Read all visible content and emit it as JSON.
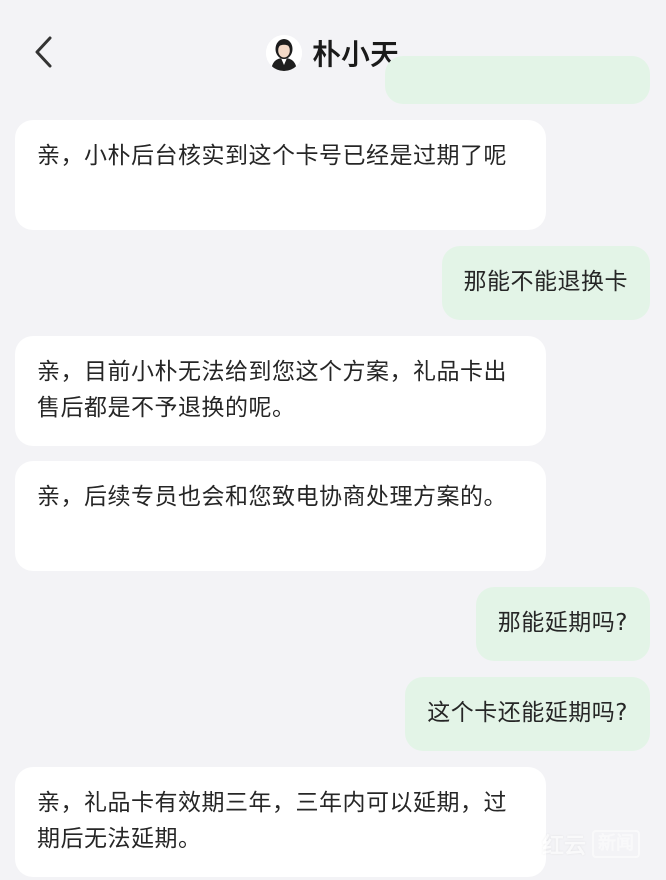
{
  "header": {
    "title": "朴小天",
    "back_icon": "chevron-left-icon",
    "avatar_icon": "agent-avatar"
  },
  "messages": [
    {
      "side": "right",
      "text": ""
    },
    {
      "side": "left",
      "text": "亲，小朴后台核实到这个卡号已经是过期了呢"
    },
    {
      "side": "right",
      "text": "那能不能退换卡"
    },
    {
      "side": "left",
      "text": "亲，目前小朴无法给到您这个方案，礼品卡出售后都是不予退换的呢。"
    },
    {
      "side": "left",
      "text": "亲，后续专员也会和您致电协商处理方案的。"
    },
    {
      "side": "right",
      "text": "那能延期吗?"
    },
    {
      "side": "right",
      "text": "这个卡还能延期吗?"
    },
    {
      "side": "left",
      "text": "亲，礼品卡有效期三年，三年内可以延期，过期后无法延期。"
    }
  ],
  "watermark": {
    "text": "红云",
    "badge": "新闻"
  },
  "colors": {
    "background": "#f3f3f6",
    "incoming_bubble": "#ffffff",
    "outgoing_bubble": "#e3f4e7"
  }
}
